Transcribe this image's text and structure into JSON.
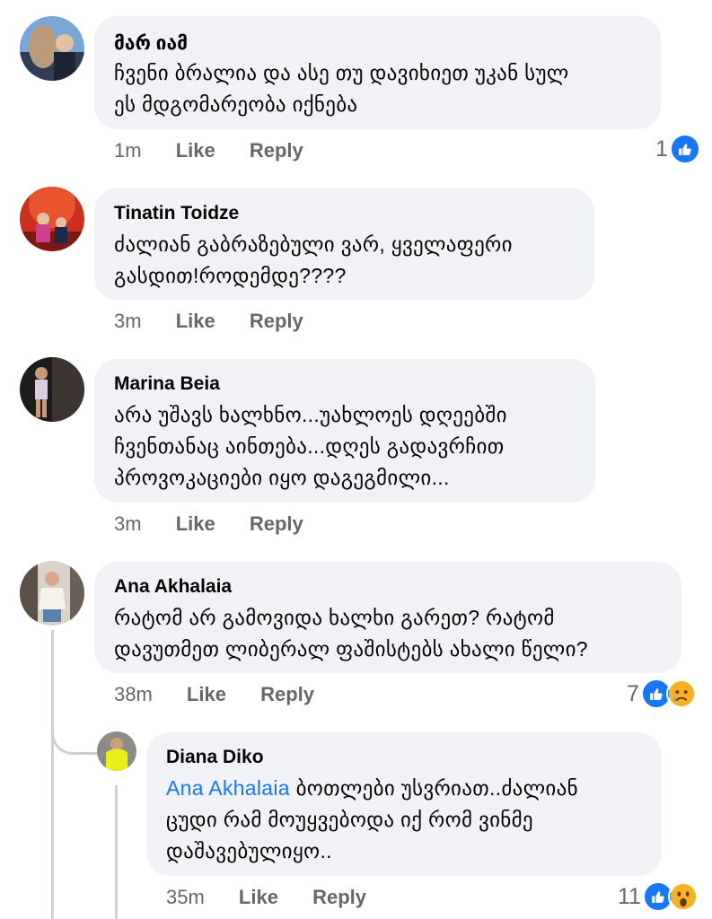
{
  "comments": [
    {
      "author": "მარ იამ",
      "lines": [
        "ჩვენი ბრალია და ასე თუ დავიხიეთ უკან სულ",
        "ეს მდგომარეობა იქნება"
      ],
      "time": "1m",
      "like": "Like",
      "reply": "Reply",
      "reactions": {
        "count": "1",
        "icons": [
          "like-icon"
        ]
      }
    },
    {
      "author": "Tinatin Toidze",
      "lines": [
        "ძალიან გაბრაზებული ვარ, ყველაფერი",
        "გასდით!როდემდე????"
      ],
      "time": "3m",
      "like": "Like",
      "reply": "Reply"
    },
    {
      "author": "Marina Beia",
      "lines": [
        "არა უშავს  ხალხნო...უახლოეს დღეებში",
        "ჩვენთანაც აინთება...დღეს გადავრჩით",
        "პროვოკაციები იყო დაგეგმილი..."
      ],
      "time": "3m",
      "like": "Like",
      "reply": "Reply"
    },
    {
      "author": "Ana Akhalaia",
      "lines": [
        "რატომ არ გამოვიდა ხალხი გარეთ? რატომ",
        "დავუთმეთ ლიბერალ ფაშისტებს ახალი წელი?"
      ],
      "time": "38m",
      "like": "Like",
      "reply": "Reply",
      "reactions": {
        "count": "7",
        "icons": [
          "like-icon",
          "sad-icon"
        ]
      }
    },
    {
      "author": "Diana Diko",
      "mention": "Ana Akhalaia",
      "lines": [
        " ბოთლები უსვრიათ..ძალიან",
        "ცუდი რამ მოუყვებოდა იქ რომ ვინმე",
        "დაშავებულიყო.."
      ],
      "time": "35m",
      "like": "Like",
      "reply": "Reply",
      "reactions": {
        "count": "11",
        "icons": [
          "like-icon",
          "wow-icon"
        ]
      }
    }
  ],
  "colors": {
    "bubble": "#f0f2f5",
    "meta": "#65676b",
    "like_blue": "#1877f2",
    "mention": "#1877f2",
    "thread_line": "#ced0d4"
  }
}
